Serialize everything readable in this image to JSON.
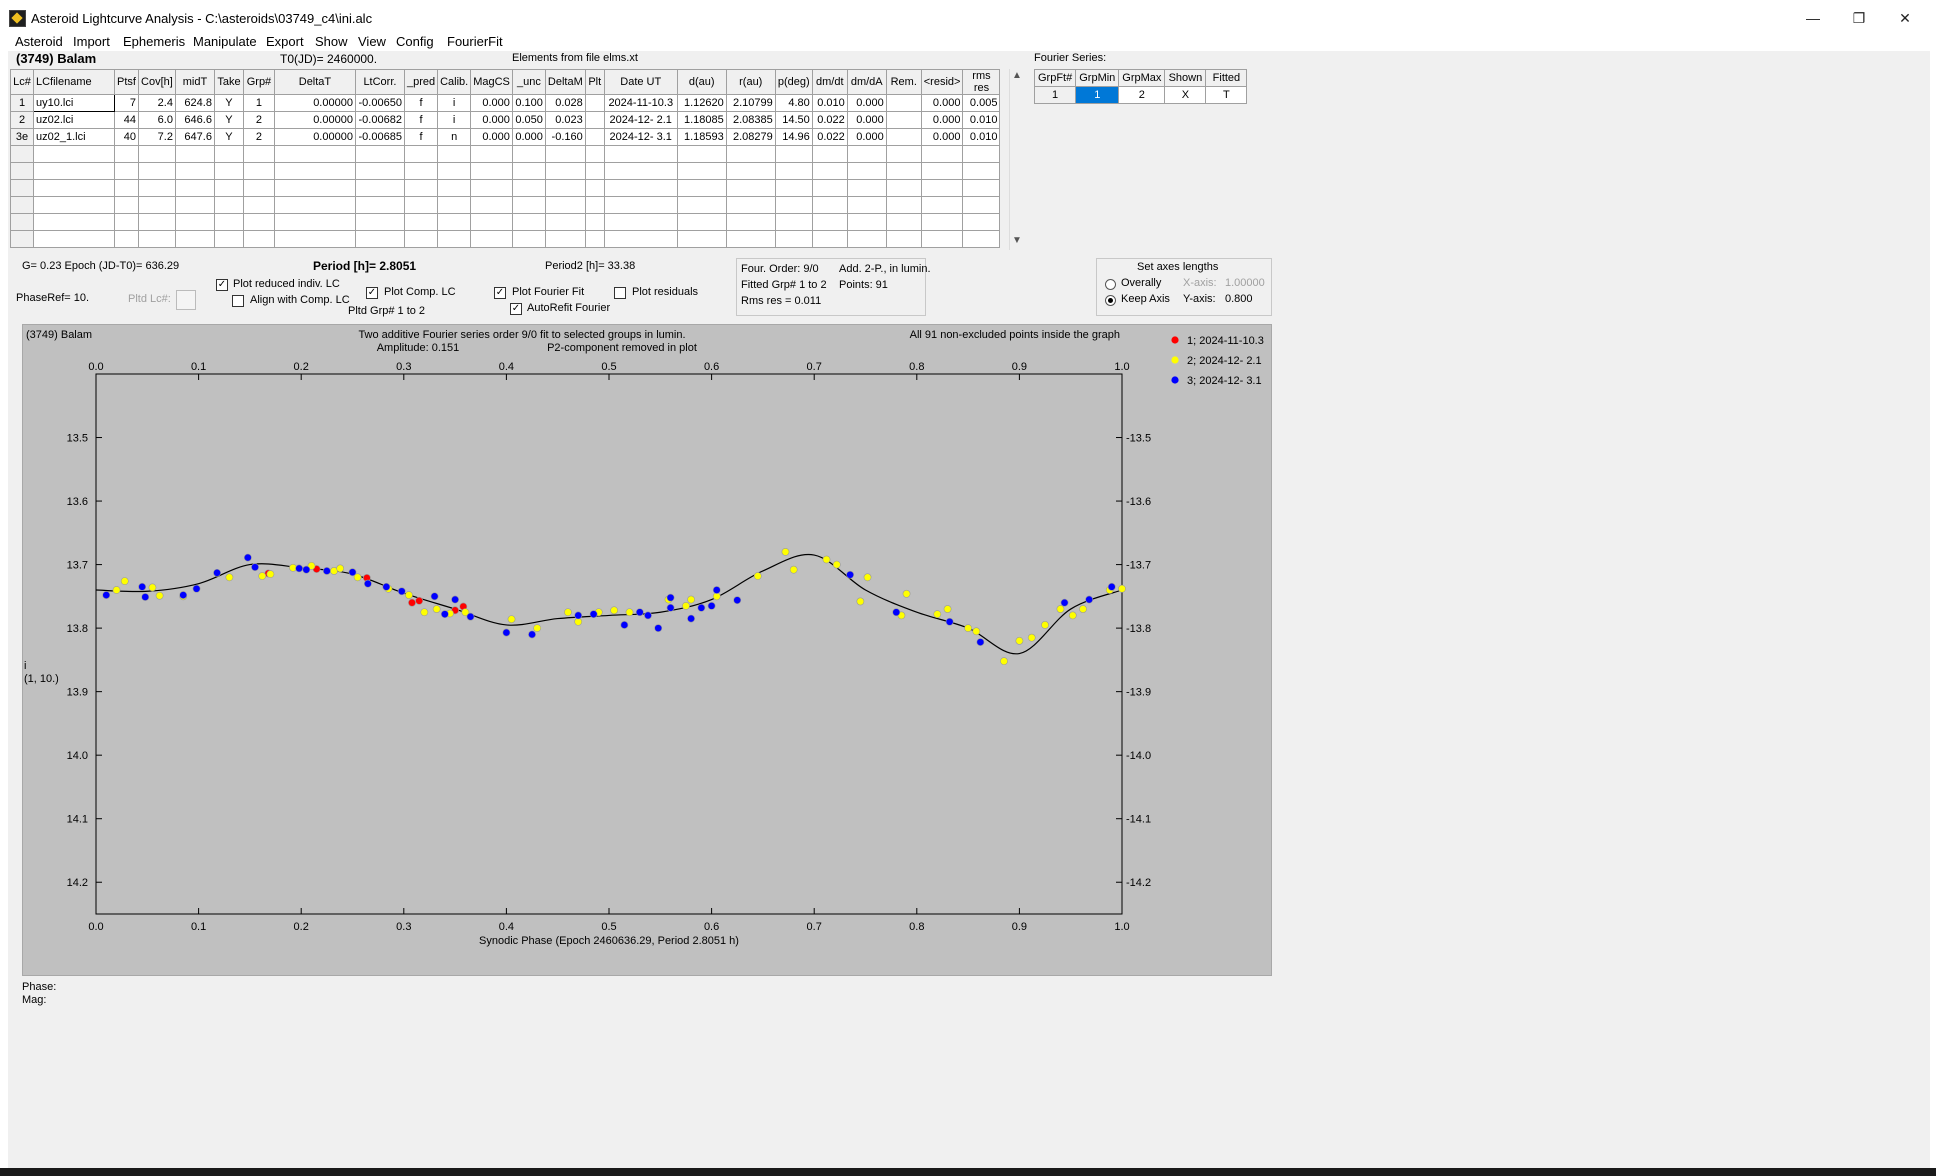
{
  "window": {
    "title": "Asteroid Lightcurve Analysis - C:\\asteroids\\03749_c4\\ini.alc",
    "minimize": "—",
    "restore": "❐",
    "close": "✕"
  },
  "menu": [
    "Asteroid",
    "Import",
    "Ephemeris",
    "Manipulate",
    "Export",
    "Show",
    "View",
    "Config",
    "FourierFit"
  ],
  "header": {
    "asteroid": "(3749) Balam",
    "t0": "T0(JD)= 2460000.",
    "elements": "Elements from file elms.xt"
  },
  "lc_table": {
    "columns": [
      "Lc#",
      "LCfilename",
      "Ptsf",
      "Cov[h]",
      "midT",
      "Take",
      "Grp#",
      "DeltaT",
      "LtCorr.",
      "_pred",
      "Calib.",
      "MagCS",
      "_unc",
      "DeltaM",
      "Plt",
      "Date UT",
      "d(au)",
      "r(au)",
      "p(deg)",
      "dm/dt",
      "dm/dA",
      "Rem.",
      "<resid>",
      "rms res"
    ],
    "rows": [
      [
        "1",
        "uy10.lci",
        "7",
        "2.4",
        "624.8",
        "Y",
        "1",
        "0.00000",
        "-0.00650",
        "f",
        "i",
        "0.000",
        "0.100",
        "0.028",
        "",
        "2024-11-10.3",
        "1.12620",
        "2.10799",
        "4.80",
        "0.010",
        "0.000",
        "",
        "0.000",
        "0.005"
      ],
      [
        "2",
        "uz02.lci",
        "44",
        "6.0",
        "646.6",
        "Y",
        "2",
        "0.00000",
        "-0.00682",
        "f",
        "i",
        "0.000",
        "0.050",
        "0.023",
        "",
        "2024-12- 2.1",
        "1.18085",
        "2.08385",
        "14.50",
        "0.022",
        "0.000",
        "",
        "0.000",
        "0.010"
      ],
      [
        "3e",
        "uz02_1.lci",
        "40",
        "7.2",
        "647.6",
        "Y",
        "2",
        "0.00000",
        "-0.00685",
        "f",
        "n",
        "0.000",
        "0.000",
        "-0.160",
        "",
        "2024-12- 3.1",
        "1.18593",
        "2.08279",
        "14.96",
        "0.022",
        "0.000",
        "",
        "0.000",
        "0.010"
      ]
    ],
    "empty_rows": 6
  },
  "fourier_series": {
    "label": "Fourier Series:",
    "columns": [
      "GrpFt#",
      "GrpMin",
      "GrpMax",
      "Shown",
      "Fitted"
    ],
    "row": [
      "1",
      "1",
      "2",
      "X",
      "T"
    ]
  },
  "controls": {
    "g_epoch": "G= 0.23   Epoch (JD-T0)= 636.29",
    "period": "Period [h]= 2.8051",
    "period2": "Period2 [h]= 33.38",
    "phaseref": "PhaseRef= 10.",
    "pltd_lc": "Pltd Lc#:",
    "plot_reduced": "Plot reduced indiv. LC",
    "align_comp": "Align with Comp. LC",
    "plot_comp": "Plot Comp. LC",
    "pltd_grp": "Pltd Grp#  1   to   2",
    "plot_fourier": "Plot Fourier Fit",
    "autorefit": "AutoRefit Fourier",
    "plot_residuals": "Plot residuals",
    "four_order": "Four. Order:  9/0",
    "add2p": "Add. 2-P., in lumin.",
    "fitted_grp": "Fitted Grp# 1 to 2",
    "points": "Points: 91",
    "rms_res": "Rms res     = 0.011",
    "axes_title": "Set axes lengths",
    "overally": "Overally",
    "keep_axis": "Keep Axis",
    "xaxis_label": "X-axis:",
    "xaxis_val": "1.00000",
    "yaxis_label": "Y-axis:",
    "yaxis_val": "0.800",
    "phase_label": "Phase:",
    "mag_label": "Mag:"
  },
  "plot": {
    "name": "(3749) Balam",
    "subtitle1": "Two additive Fourier series order 9/0 fit to selected groups in lumin.",
    "amplitude": "Amplitude: 0.151",
    "p2removed": "P2-component removed in plot",
    "allpoints": "All 91 non-excluded points inside the graph",
    "ylabel1": "i",
    "ylabel2": "(1, 10.)",
    "xlabel": "Synodic Phase (Epoch 2460636.29, Period 2.8051 h)",
    "colors": {
      "bg": "#c0c0c0",
      "red": "#ff0000",
      "yellow": "#ffff00",
      "blue": "#0000ff"
    },
    "legend": [
      {
        "label": "1; 2024-11-10.3",
        "color": "#ff0000"
      },
      {
        "label": "2; 2024-12- 2.1",
        "color": "#ffff00"
      },
      {
        "label": "3; 2024-12- 3.1",
        "color": "#0000ff"
      }
    ]
  },
  "chart_data": {
    "type": "scatter",
    "xlim": [
      0,
      1
    ],
    "ylim": [
      13.4,
      14.25
    ],
    "y_inverted": true,
    "xticks": [
      0.0,
      0.1,
      0.2,
      0.3,
      0.4,
      0.5,
      0.6,
      0.7,
      0.8,
      0.9,
      1.0
    ],
    "yticks": [
      13.5,
      13.6,
      13.7,
      13.8,
      13.9,
      14.0,
      14.1,
      14.2
    ],
    "series": [
      {
        "name": "1; 2024-11-10.3",
        "color": "#ff0000",
        "points": [
          [
            0.168,
            13.714
          ],
          [
            0.215,
            13.707
          ],
          [
            0.264,
            13.721
          ],
          [
            0.308,
            13.76
          ],
          [
            0.315,
            13.757
          ],
          [
            0.35,
            13.772
          ],
          [
            0.358,
            13.766
          ]
        ]
      },
      {
        "name": "2; 2024-12- 2.1",
        "color": "#ffff00",
        "points": [
          [
            0.02,
            13.74
          ],
          [
            0.028,
            13.726
          ],
          [
            0.055,
            13.736
          ],
          [
            0.062,
            13.749
          ],
          [
            0.085,
            13.75
          ],
          [
            0.13,
            13.72
          ],
          [
            0.162,
            13.718
          ],
          [
            0.17,
            13.715
          ],
          [
            0.192,
            13.705
          ],
          [
            0.21,
            13.702
          ],
          [
            0.232,
            13.71
          ],
          [
            0.238,
            13.706
          ],
          [
            0.255,
            13.72
          ],
          [
            0.285,
            13.738
          ],
          [
            0.305,
            13.748
          ],
          [
            0.32,
            13.775
          ],
          [
            0.332,
            13.77
          ],
          [
            0.345,
            13.777
          ],
          [
            0.36,
            13.775
          ],
          [
            0.405,
            13.786
          ],
          [
            0.43,
            13.8
          ],
          [
            0.46,
            13.775
          ],
          [
            0.47,
            13.79
          ],
          [
            0.49,
            13.775
          ],
          [
            0.505,
            13.772
          ],
          [
            0.52,
            13.775
          ],
          [
            0.558,
            13.755
          ],
          [
            0.575,
            13.765
          ],
          [
            0.58,
            13.755
          ],
          [
            0.605,
            13.75
          ],
          [
            0.645,
            13.718
          ],
          [
            0.672,
            13.68
          ],
          [
            0.68,
            13.708
          ],
          [
            0.712,
            13.692
          ],
          [
            0.722,
            13.7
          ],
          [
            0.745,
            13.758
          ],
          [
            0.752,
            13.72
          ],
          [
            0.785,
            13.78
          ],
          [
            0.79,
            13.746
          ],
          [
            0.82,
            13.778
          ],
          [
            0.83,
            13.77
          ],
          [
            0.85,
            13.8
          ],
          [
            0.858,
            13.805
          ],
          [
            0.885,
            13.852
          ],
          [
            0.9,
            13.82
          ],
          [
            0.912,
            13.815
          ],
          [
            0.925,
            13.795
          ],
          [
            0.94,
            13.77
          ],
          [
            0.952,
            13.78
          ],
          [
            0.962,
            13.77
          ],
          [
            0.988,
            13.74
          ],
          [
            1.0,
            13.738
          ]
        ]
      },
      {
        "name": "3; 2024-12- 3.1",
        "color": "#0000ff",
        "points": [
          [
            0.01,
            13.748
          ],
          [
            0.045,
            13.735
          ],
          [
            0.048,
            13.751
          ],
          [
            0.085,
            13.748
          ],
          [
            0.098,
            13.738
          ],
          [
            0.118,
            13.713
          ],
          [
            0.148,
            13.689
          ],
          [
            0.155,
            13.704
          ],
          [
            0.198,
            13.706
          ],
          [
            0.205,
            13.708
          ],
          [
            0.225,
            13.71
          ],
          [
            0.25,
            13.712
          ],
          [
            0.265,
            13.73
          ],
          [
            0.283,
            13.735
          ],
          [
            0.298,
            13.742
          ],
          [
            0.33,
            13.75
          ],
          [
            0.34,
            13.778
          ],
          [
            0.35,
            13.755
          ],
          [
            0.365,
            13.782
          ],
          [
            0.4,
            13.807
          ],
          [
            0.425,
            13.81
          ],
          [
            0.47,
            13.78
          ],
          [
            0.485,
            13.778
          ],
          [
            0.515,
            13.795
          ],
          [
            0.53,
            13.775
          ],
          [
            0.538,
            13.78
          ],
          [
            0.548,
            13.8
          ],
          [
            0.56,
            13.768
          ],
          [
            0.56,
            13.752
          ],
          [
            0.58,
            13.785
          ],
          [
            0.59,
            13.768
          ],
          [
            0.605,
            13.74
          ],
          [
            0.6,
            13.765
          ],
          [
            0.625,
            13.756
          ],
          [
            0.735,
            13.716
          ],
          [
            0.78,
            13.775
          ],
          [
            0.832,
            13.79
          ],
          [
            0.862,
            13.822
          ],
          [
            0.944,
            13.76
          ],
          [
            0.968,
            13.755
          ],
          [
            0.99,
            13.735
          ]
        ]
      }
    ],
    "fourier_fit": [
      [
        0.0,
        13.74
      ],
      [
        0.05,
        13.742
      ],
      [
        0.1,
        13.73
      ],
      [
        0.15,
        13.7
      ],
      [
        0.2,
        13.705
      ],
      [
        0.25,
        13.715
      ],
      [
        0.3,
        13.745
      ],
      [
        0.35,
        13.77
      ],
      [
        0.4,
        13.795
      ],
      [
        0.45,
        13.785
      ],
      [
        0.5,
        13.78
      ],
      [
        0.55,
        13.775
      ],
      [
        0.6,
        13.755
      ],
      [
        0.65,
        13.71
      ],
      [
        0.7,
        13.685
      ],
      [
        0.75,
        13.74
      ],
      [
        0.8,
        13.775
      ],
      [
        0.85,
        13.8
      ],
      [
        0.9,
        13.84
      ],
      [
        0.95,
        13.77
      ],
      [
        1.0,
        13.74
      ]
    ]
  }
}
